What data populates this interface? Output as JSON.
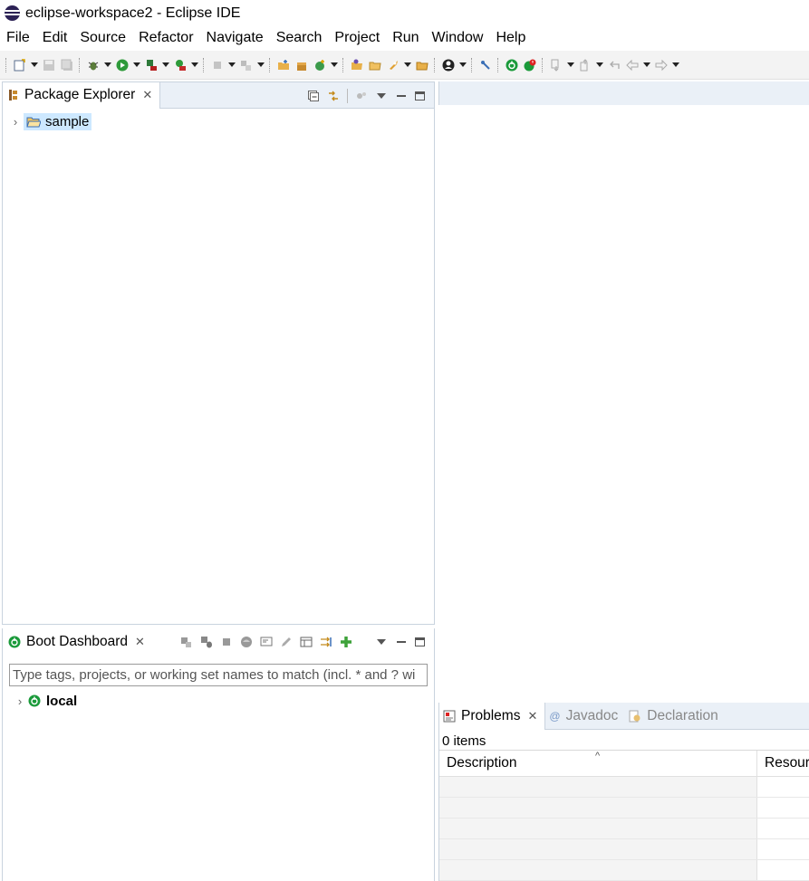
{
  "window": {
    "title": "eclipse-workspace2 - Eclipse IDE"
  },
  "menu": [
    "File",
    "Edit",
    "Source",
    "Refactor",
    "Navigate",
    "Search",
    "Project",
    "Run",
    "Window",
    "Help"
  ],
  "toolbar": {
    "icons": [
      "new-icon",
      "save-icon",
      "save-all-icon",
      "debug-icon",
      "run-icon",
      "coverage-icon",
      "external-tools-icon",
      "stop-icon",
      "skip-icon",
      "new-java-project-icon",
      "new-package-icon",
      "new-class-icon",
      "open-type-icon",
      "open-resource-icon",
      "rocket-icon",
      "open-folder-icon",
      "profile-icon",
      "pin-icon",
      "spring-boot-icon",
      "spring-boot-alert-icon",
      "next-annotation-icon",
      "prev-annotation-icon",
      "last-edit-icon",
      "back-icon",
      "forward-icon"
    ]
  },
  "package_explorer": {
    "tab_label": "Package Explorer",
    "tree": [
      {
        "label": "sample",
        "selected": true
      }
    ]
  },
  "boot_dashboard": {
    "tab_label": "Boot Dashboard",
    "filter_placeholder": "Type tags, projects, or working set names to match (incl. * and ? wi",
    "tree": [
      {
        "label": "local"
      }
    ]
  },
  "problems": {
    "tabs": [
      {
        "label": "Problems",
        "active": true
      },
      {
        "label": "Javadoc",
        "active": false
      },
      {
        "label": "Declaration",
        "active": false
      }
    ],
    "count_text": "0 items",
    "columns": [
      "Description",
      "Resourc"
    ],
    "empty_rows": 5
  },
  "colors": {
    "selection": "#cde8ff",
    "tab_bar": "#eaf0f7",
    "spring_green": "#1a9a3a"
  }
}
